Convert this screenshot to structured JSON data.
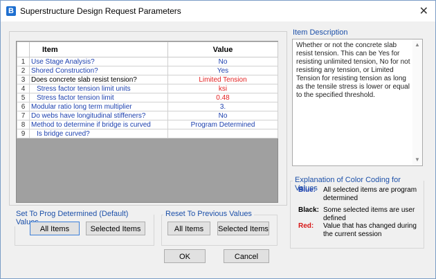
{
  "window": {
    "title": "Superstructure Design Request Parameters",
    "icon_letter": "B",
    "close_glyph": "✕"
  },
  "grid": {
    "headers": {
      "item": "Item",
      "value": "Value"
    },
    "rows": [
      {
        "num": "1",
        "item": "Use Stage Analysis?",
        "value": "No",
        "item_color": "blue",
        "value_color": "blue"
      },
      {
        "num": "2",
        "item": "Shored Construction?",
        "value": "Yes",
        "item_color": "blue",
        "value_color": "blue"
      },
      {
        "num": "3",
        "item": "Does concrete slab resist tension?",
        "value": "Limited Tension",
        "item_color": "black",
        "value_color": "red"
      },
      {
        "num": "4",
        "item": "Stress factor tension limit units",
        "value": "ksi",
        "item_color": "blue",
        "value_color": "red"
      },
      {
        "num": "5",
        "item": "Stress factor tension limit",
        "value": "0.48",
        "item_color": "blue",
        "value_color": "red"
      },
      {
        "num": "6",
        "item": "Modular ratio long term multiplier",
        "value": "3.",
        "item_color": "blue",
        "value_color": "blue"
      },
      {
        "num": "7",
        "item": "Do webs have longitudinal stiffeners?",
        "value": "No",
        "item_color": "blue",
        "value_color": "blue"
      },
      {
        "num": "8",
        "item": "Method to determine if bridge is curved",
        "value": "Program Determined",
        "item_color": "blue",
        "value_color": "blue"
      },
      {
        "num": "9",
        "item": "Is bridge curved?",
        "value": "",
        "item_color": "blue",
        "value_color": "blue"
      }
    ]
  },
  "item_description": {
    "label": "Item Description",
    "text": "Whether or not the concrete slab resist tension. This can be Yes for resisting unlimited tension, No for not resisting any tension, or Limited Tension for resisting tension as long as the tensile stress is lower or equal to the specified threshold."
  },
  "color_coding": {
    "label": "Explanation of Color Coding for Values",
    "entries": [
      {
        "key": "Blue:",
        "text": "All selected items are program determined",
        "color": "#1b3fae"
      },
      {
        "key": "Black:",
        "text": "Some selected items are user defined",
        "color": "#000000"
      },
      {
        "key": "Red:",
        "text": "Value that has changed during the current session",
        "color": "#d71414"
      }
    ]
  },
  "set_default_group": {
    "label": "Set To Prog Determined (Default) Values",
    "all_items": "All Items",
    "selected_items": "Selected Items"
  },
  "reset_group": {
    "label": "Reset To Previous Values",
    "all_items": "All Items",
    "selected_items": "Selected Items"
  },
  "footer": {
    "ok": "OK",
    "cancel": "Cancel"
  }
}
